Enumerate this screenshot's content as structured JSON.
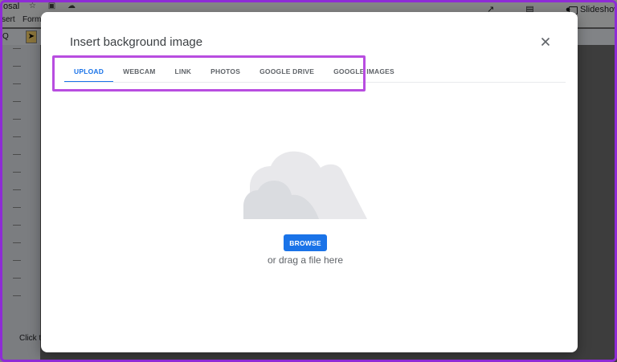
{
  "background_app": {
    "title": "osal",
    "menu_items": [
      "sert",
      "Form"
    ],
    "zoom_label": "Q",
    "slideshow_label": "Slideshow",
    "speaker_notes": "Click t"
  },
  "dialog": {
    "title": "Insert background image",
    "close_icon": "close-icon",
    "tabs": [
      {
        "label": "UPLOAD",
        "active": true
      },
      {
        "label": "WEBCAM",
        "active": false
      },
      {
        "label": "LINK",
        "active": false
      },
      {
        "label": "PHOTOS",
        "active": false
      },
      {
        "label": "GOOGLE DRIVE",
        "active": false
      },
      {
        "label": "GOOGLE IMAGES",
        "active": false
      }
    ],
    "upload": {
      "illustration": "cloud-illustration",
      "browse_label": "BROWSE",
      "drag_text": "or drag a file here"
    }
  },
  "colors": {
    "accent": "#1a73e8",
    "highlight": "#b84de0",
    "frame": "#8e2bd6"
  }
}
